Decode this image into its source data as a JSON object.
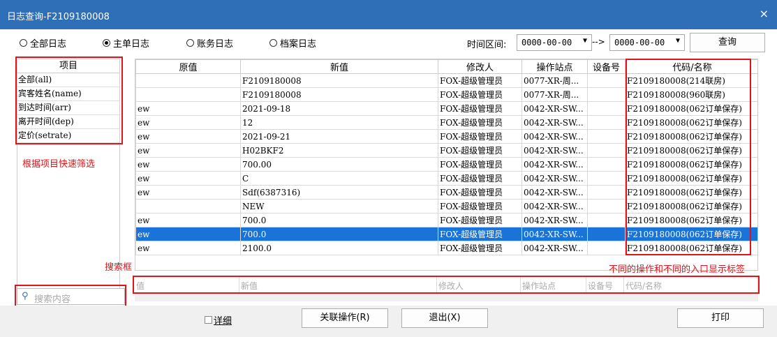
{
  "window": {
    "title": "日志查询-F2109180008",
    "close": "×"
  },
  "radios": [
    {
      "label": "全部日志",
      "checked": false
    },
    {
      "label": "主单日志",
      "checked": true
    },
    {
      "label": "账务日志",
      "checked": false
    },
    {
      "label": "档案日志",
      "checked": false
    }
  ],
  "time": {
    "label": "时间区间:",
    "from": "0000-00-00",
    "sep": "-->",
    "to": "0000-00-00",
    "query": "查询"
  },
  "items": {
    "header": "项目",
    "rows": [
      "全部(all)",
      "宾客姓名(name)",
      "到达时间(arr)",
      "离开时间(dep)",
      "定价(setrate)"
    ]
  },
  "table": {
    "columns": [
      "原值",
      "新值",
      "修改人",
      "操作站点",
      "设备号",
      "代码/名称"
    ],
    "rows": [
      [
        "",
        "F2109180008",
        "FOX-超级管理员",
        "0077-XR-周...",
        "",
        "F2109180008(214联房)"
      ],
      [
        "",
        "F2109180008",
        "FOX-超级管理员",
        "0077-XR-周...",
        "",
        "F2109180008(960联房)"
      ],
      [
        "ew",
        "2021-09-18",
        "FOX-超级管理员",
        "0042-XR-SW...",
        "",
        "F2109180008(062订单保存)"
      ],
      [
        "ew",
        "12",
        "FOX-超级管理员",
        "0042-XR-SW...",
        "",
        "F2109180008(062订单保存)"
      ],
      [
        "ew",
        "2021-09-21",
        "FOX-超级管理员",
        "0042-XR-SW...",
        "",
        "F2109180008(062订单保存)"
      ],
      [
        "ew",
        "H02BKF2",
        "FOX-超级管理员",
        "0042-XR-SW...",
        "",
        "F2109180008(062订单保存)"
      ],
      [
        "ew",
        "700.00",
        "FOX-超级管理员",
        "0042-XR-SW...",
        "",
        "F2109180008(062订单保存)"
      ],
      [
        "ew",
        "C",
        "FOX-超级管理员",
        "0042-XR-SW...",
        "",
        "F2109180008(062订单保存)"
      ],
      [
        "ew",
        "Sdf(6387316)",
        "FOX-超级管理员",
        "0042-XR-SW...",
        "",
        "F2109180008(062订单保存)"
      ],
      [
        "",
        "NEW",
        "FOX-超级管理员",
        "0042-XR-SW...",
        "",
        "F2109180008(062订单保存)"
      ],
      [
        "ew",
        "700.0",
        "FOX-超级管理员",
        "0042-XR-SW...",
        "",
        "F2109180008(062订单保存)"
      ],
      [
        "ew",
        "700.0",
        "FOX-超级管理员",
        "0042-XR-SW...",
        "",
        "F2109180008(062订单保存)"
      ],
      [
        "ew",
        "2100.0",
        "FOX-超级管理员",
        "0042-XR-SW...",
        "",
        "F2109180008(062订单保存)"
      ]
    ],
    "selected_row": 11
  },
  "filter": {
    "placeholders": [
      "值",
      "新值",
      "修改人",
      "操作站点",
      "设备号",
      "代码/名称"
    ]
  },
  "search": {
    "placeholder": "搜索内容"
  },
  "annotations": {
    "filter_tip": "根据项目快速筛选",
    "search_box": "搜索框",
    "tags_tip": "不同的操作和不同的入口显示标签"
  },
  "bottom": {
    "detail": "详细",
    "linked": "关联操作(R)",
    "exit": "退出(X)",
    "print": "打印"
  }
}
